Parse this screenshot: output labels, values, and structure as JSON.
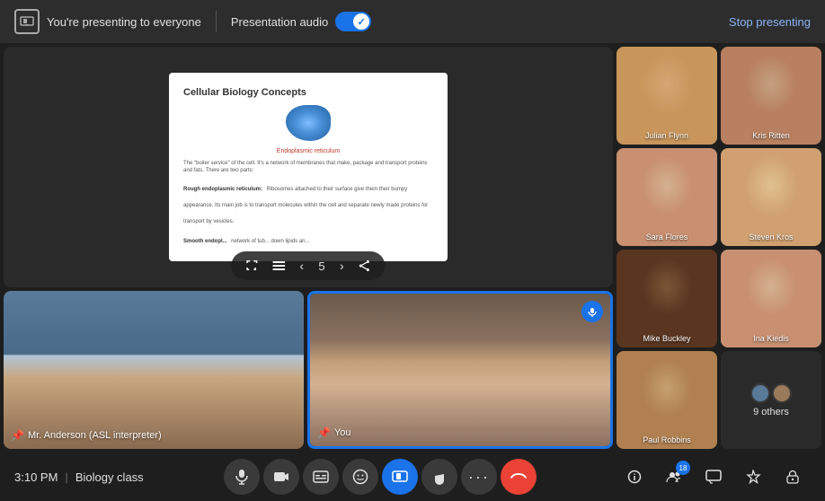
{
  "topbar": {
    "presenting_label": "You're presenting to everyone",
    "audio_label": "Presentation audio",
    "stop_btn": "Stop presenting"
  },
  "slide": {
    "title": "Cellular Biology Concepts",
    "cell_name": "Endoplasmic reticulum",
    "body1": "The \"boiler service\" of the cell. It's a network of membranes that make, package and transport proteins and fats. There are two parts:",
    "bold1": "Rough endoplasmic reticulum:",
    "body2": "Ribosomes attached to their surface give them their bumpy appearance. Its main job is to transport molecules within the cell and separate newly made proteins for transport by vesicles.",
    "bold2": "Smooth endopl...",
    "body3": "network of tub... down lipids an...",
    "current_page": "5",
    "total_pages": ""
  },
  "participants": [
    {
      "name": "Julian Flynn",
      "face_class": "face-male-1"
    },
    {
      "name": "Kris Ritten",
      "face_class": "face-female-1"
    },
    {
      "name": "Sara Flores",
      "face_class": "face-female-2"
    },
    {
      "name": "Steven Kros",
      "face_class": "face-male-2"
    },
    {
      "name": "Mike Buckley",
      "face_class": "face-male-3"
    },
    {
      "name": "Ina Kiedis",
      "face_class": "face-female-3"
    },
    {
      "name": "Paul Robbins",
      "face_class": "face-male-4"
    }
  ],
  "others": {
    "label": "9 others"
  },
  "tiles": {
    "anderson": "Mr. Anderson (ASL interpreter)",
    "you": "You"
  },
  "bottombar": {
    "time": "3:10 PM",
    "class": "Biology class",
    "badge_count": "18"
  }
}
